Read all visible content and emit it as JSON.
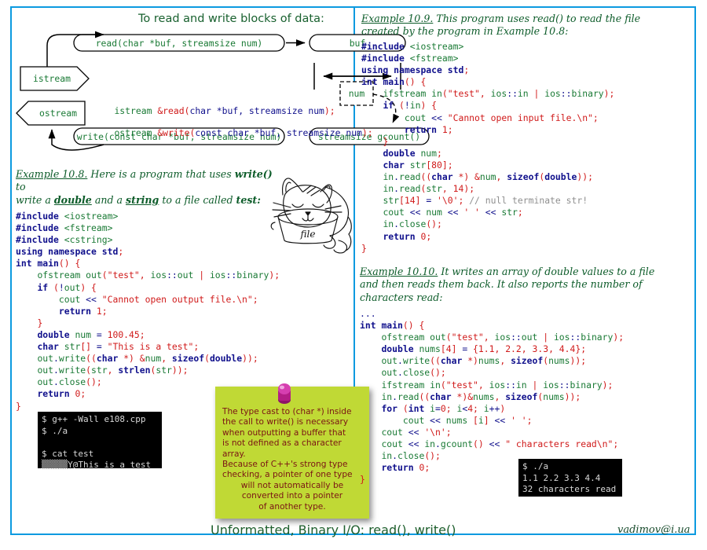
{
  "slide": {
    "diagram_title": "To read and write blocks of data:",
    "footer_title": "Unformatted, Binary I/O: read(), write()",
    "footer_author": "vadimov@i.ua",
    "frame_color": "#0c9ae0"
  },
  "diagram": {
    "node_read": "read(char *buf, streamsize num)",
    "node_buf": "buf",
    "node_write": "write(const char *buf, streamsize num)",
    "node_gcount": "streamsize gcount()",
    "node_num": "num",
    "tag_istream": "istream",
    "tag_ostream": "ostream",
    "sig_read": {
      "ret": "istream ",
      "name": "&read",
      "open": "(",
      "args": "char *buf, streamsize num",
      "close": ");"
    },
    "sig_write": {
      "ret": "ostream ",
      "name": "&write",
      "open": "(",
      "args": "const char *buf, streamsize num",
      "close": ");"
    }
  },
  "example_108": {
    "heading_label": "Example 10.8.",
    "heading_rest_1": " Here is a program that uses ",
    "heading_bold_1": "write()",
    "heading_rest_2": " to",
    "line2_a": "write a ",
    "line2_b": "double",
    "line2_c": " and a ",
    "line2_d": "string",
    "line2_e": " to a  file called ",
    "line2_f": "test:",
    "code": [
      "#include <iostream>",
      "#include <fstream>",
      "#include <cstring>",
      "using namespace std;",
      "int main() {",
      "    ofstream out(\"test\", ios::out | ios::binary);",
      "    if (!out) {",
      "        cout << \"Cannot open output file.\\n\";",
      "        return 1;",
      "    }",
      "    double num = 100.45;",
      "    char str[] = \"This is a test\";",
      "    out.write((char *) &num, sizeof(double));",
      "    out.write(str, strlen(str));",
      "    out.close();",
      "    return 0;",
      "}"
    ],
    "terminal": [
      "$ g++ -Wall e108.cpp",
      "$ ./a",
      "",
      "$ cat test",
      "▒▒▒▒▒Y@This is a test"
    ]
  },
  "example_109": {
    "heading_label": "Example 10.9.",
    "heading_rest_1": " This program uses read() to read the file",
    "heading_line2": "created by the program in Example 10.8:",
    "code": [
      "#include <iostream>",
      "#include <fstream>",
      "using namespace std;",
      "int main() {",
      "    ifstream in(\"test\", ios::in | ios::binary);",
      "    if (!in) {",
      "        cout << \"Cannot open input file.\\n\";",
      "        return 1;",
      "    }",
      "    double num;",
      "    char str[80];",
      "    in.read((char *) &num, sizeof(double));",
      "    in.read(str, 14);",
      "    str[14] = '\\0'; // null terminate str!",
      "    cout << num << ' ' << str;",
      "    in.close();",
      "    return 0;",
      "}"
    ]
  },
  "example_1010": {
    "heading_label": "Example 10.10.",
    "heading_rest_1": " It writes an array of double values to a file",
    "heading_line2": "and then reads them back. It also reports the number of",
    "heading_line3": "characters read:",
    "code": [
      "...",
      "int main() {",
      "    ofstream out(\"test\", ios::out | ios::binary);",
      "    double nums[4] = {1.1, 2.2, 3.3, 4.4};",
      "    out.write((char *)nums, sizeof(nums));",
      "    out.close();",
      "    ifstream in(\"test\", ios::in | ios::binary);",
      "    in.read((char *)&nums, sizeof(nums));",
      "    for (int i=0; i<4; i++)",
      "        cout << nums [i] << ' ';",
      "    cout << '\\n';",
      "    cout << in.gcount() << \" characters read\\n\";",
      "    in.close();",
      "    return 0;",
      "}"
    ],
    "terminal": [
      "$ ./a",
      "1.1 2.2 3.3 4.4",
      "32 characters read"
    ]
  },
  "sticky_note": {
    "color": "#c0d935",
    "pin_color": "#c2218f",
    "lines": [
      "The type cast to (char *) inside",
      "the call to write() is necessary",
      "when outputting a buffer that",
      "is not defined as a character",
      "array.",
      "Because of C++'s strong type",
      "checking, a pointer of one type"
    ],
    "lines_centered": [
      "will not automatically be",
      "converted into a pointer",
      "of another type."
    ]
  },
  "cat_drawing": {
    "bowl_label": "file"
  }
}
